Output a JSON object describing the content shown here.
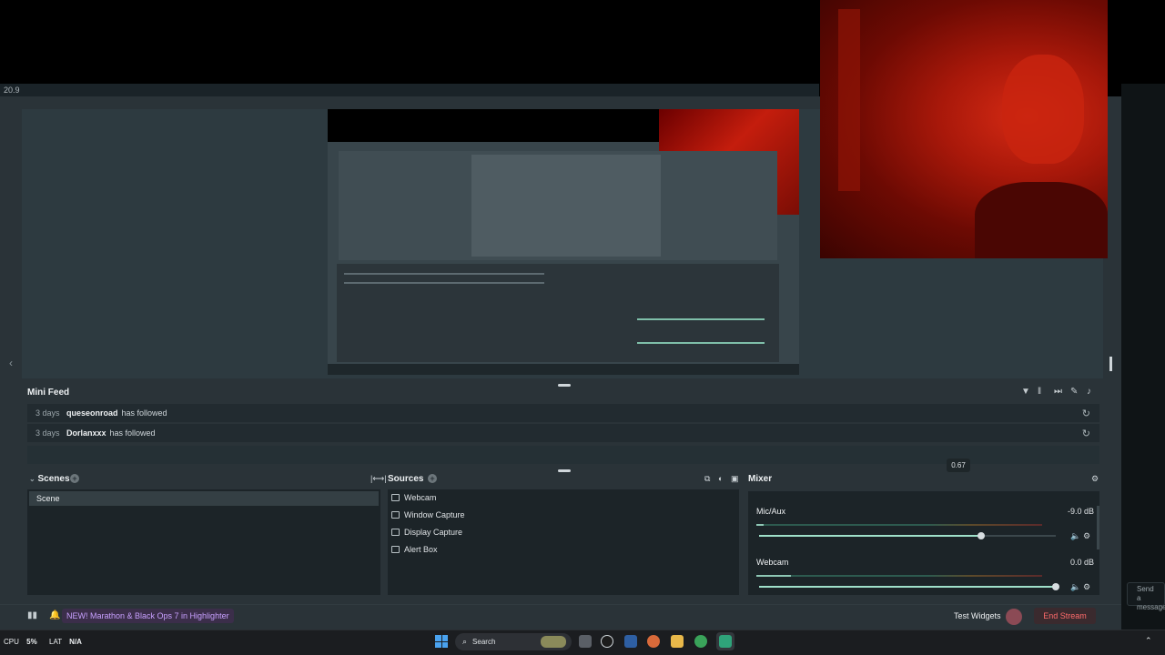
{
  "app": {
    "version": "20.9"
  },
  "preview": {
    "collapse_arrow": "‹"
  },
  "mini_feed": {
    "title": "Mini Feed",
    "events": [
      {
        "time": "3 days",
        "user": "queseonroad",
        "action": "has followed"
      },
      {
        "time": "3 days",
        "user": "Dorlanxxx",
        "action": "has followed"
      }
    ]
  },
  "scenes": {
    "title": "Scenes",
    "items": [
      "Scene"
    ]
  },
  "sources": {
    "title": "Sources",
    "items": [
      {
        "label": "Webcam",
        "icon": "webcam-icon"
      },
      {
        "label": "Window Capture",
        "icon": "window-icon"
      },
      {
        "label": "Display Capture",
        "icon": "display-icon"
      },
      {
        "label": "Alert Box",
        "icon": "alert-box-icon"
      }
    ]
  },
  "mixer": {
    "title": "Mixer",
    "tooltip": "0.67",
    "channels": [
      {
        "name": "Mic/Aux",
        "db": "-9.0 dB",
        "volume": 0.67
      },
      {
        "name": "Webcam",
        "db": "0.0 dB",
        "volume": 1.0
      }
    ]
  },
  "bottom_bar": {
    "highlighter": "NEW! Marathon & Black Ops 7 in Highlighter",
    "test_widgets": "Test Widgets",
    "end_stream": "End Stream"
  },
  "taskbar": {
    "cpu_label": "CPU",
    "cpu_value": "5%",
    "lat_label": "LAT",
    "lat_value": "N/A",
    "search": "Search"
  },
  "chat": {
    "send_message": "Send a message"
  },
  "colors": {
    "accent": "#9fe0ca",
    "end_stream": "#ff6b6b",
    "highlighter": "#c8a0ff"
  }
}
